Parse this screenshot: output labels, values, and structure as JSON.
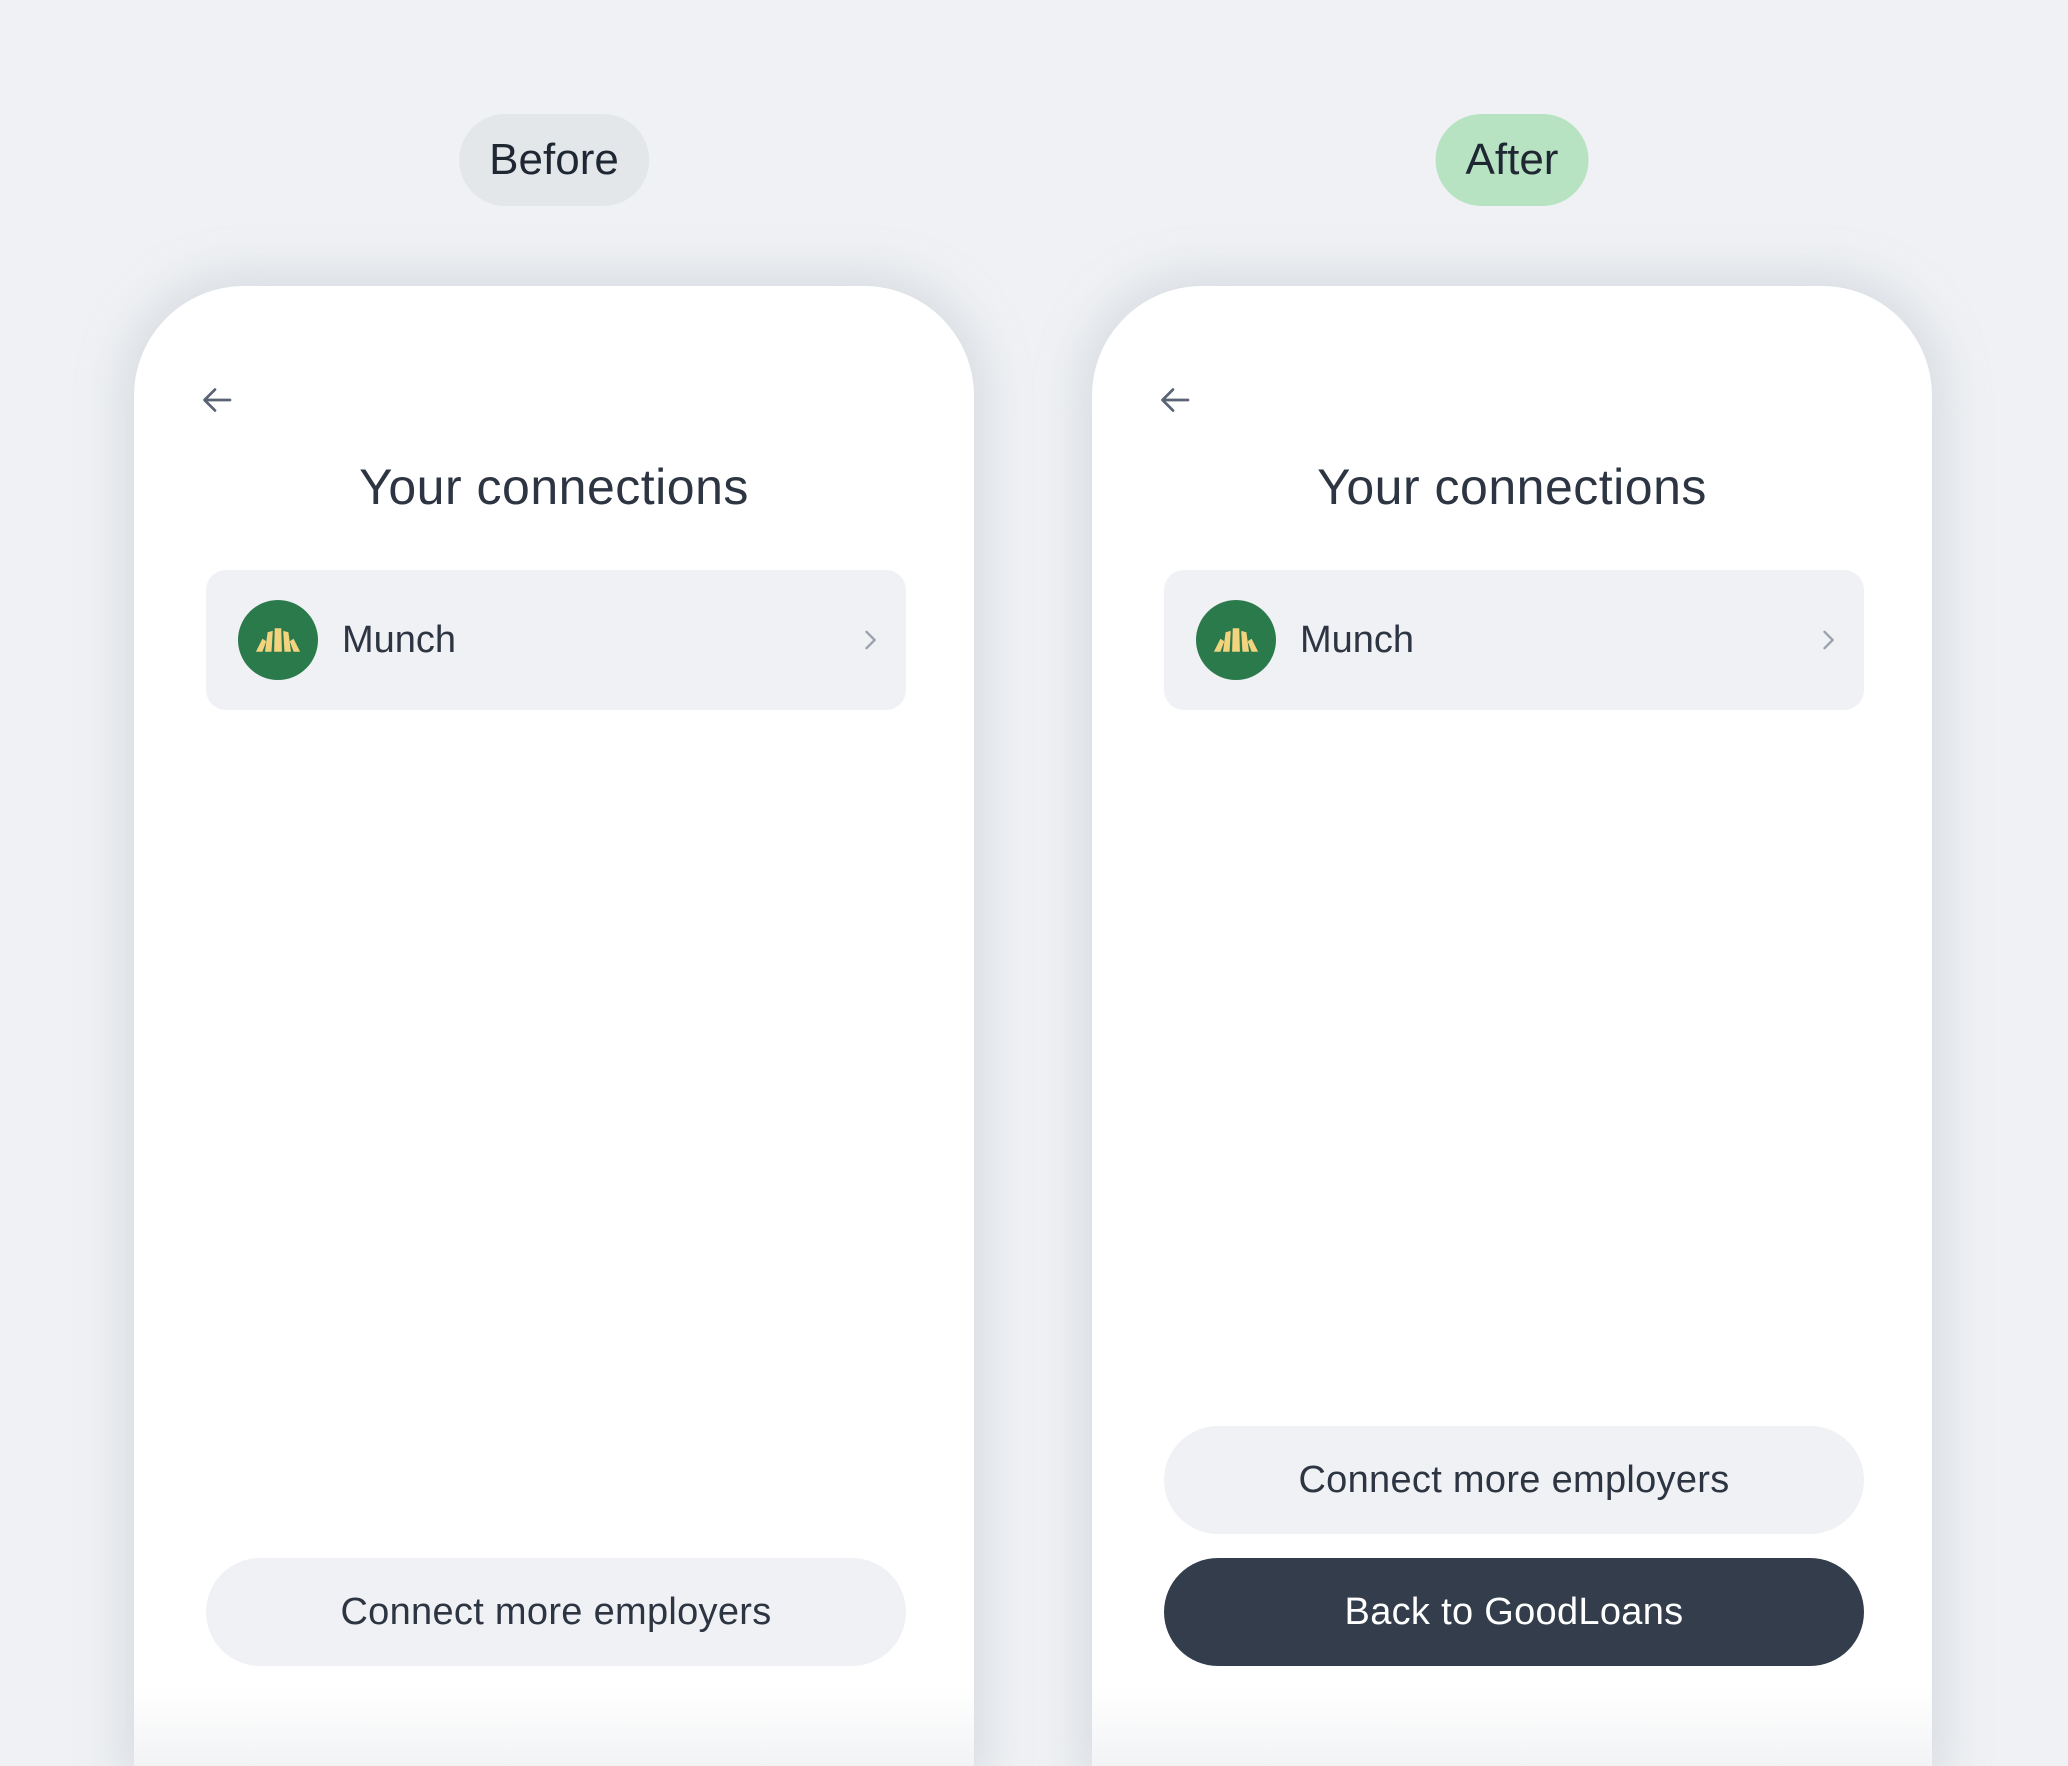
{
  "before": {
    "label": "Before",
    "screen": {
      "title": "Your connections",
      "connections": [
        {
          "name": "Munch",
          "icon": "croissant-icon"
        }
      ],
      "buttons": {
        "connect_more": "Connect more employers"
      }
    }
  },
  "after": {
    "label": "After",
    "screen": {
      "title": "Your connections",
      "connections": [
        {
          "name": "Munch",
          "icon": "croissant-icon"
        }
      ],
      "buttons": {
        "connect_more": "Connect more employers",
        "back_to_app": "Back to GoodLoans"
      }
    }
  },
  "colors": {
    "page_background": "#eff1f4",
    "before_label_bg": "#e3e7ea",
    "after_label_bg": "#b7e3c2",
    "avatar_green": "#2b7a4b",
    "avatar_icon": "#f3d37d",
    "primary_button": "#333d4b",
    "text": "#2d3543"
  }
}
